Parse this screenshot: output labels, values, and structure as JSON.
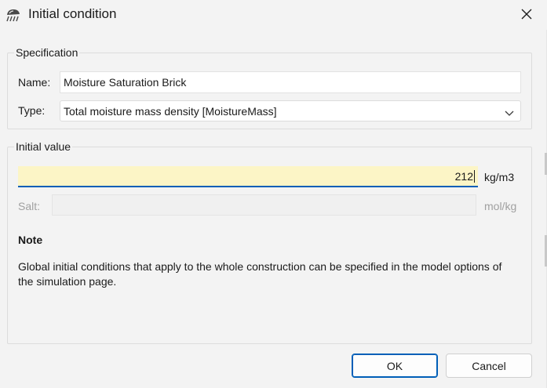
{
  "window": {
    "title": "Initial condition",
    "app_icon": "rain-cloud-icon",
    "close_icon": "close-icon"
  },
  "specification": {
    "group_title": "Specification",
    "name_label": "Name:",
    "name_value": "Moisture Saturation Brick",
    "type_label": "Type:",
    "type_value": "Total moisture mass density [MoistureMass]"
  },
  "initial_value": {
    "group_title": "Initial value",
    "value": "212",
    "unit": "kg/m3",
    "salt_label": "Salt:",
    "salt_value": "",
    "salt_unit": "mol/kg",
    "note_title": "Note",
    "note_text": "Global initial conditions that apply to the whole construction can be specified in the model options of the simulation page."
  },
  "buttons": {
    "ok": "OK",
    "cancel": "Cancel"
  },
  "colors": {
    "accent": "#005fb8",
    "input_highlight": "#fcf5c6",
    "dialog_bg": "#f3f3f3"
  }
}
